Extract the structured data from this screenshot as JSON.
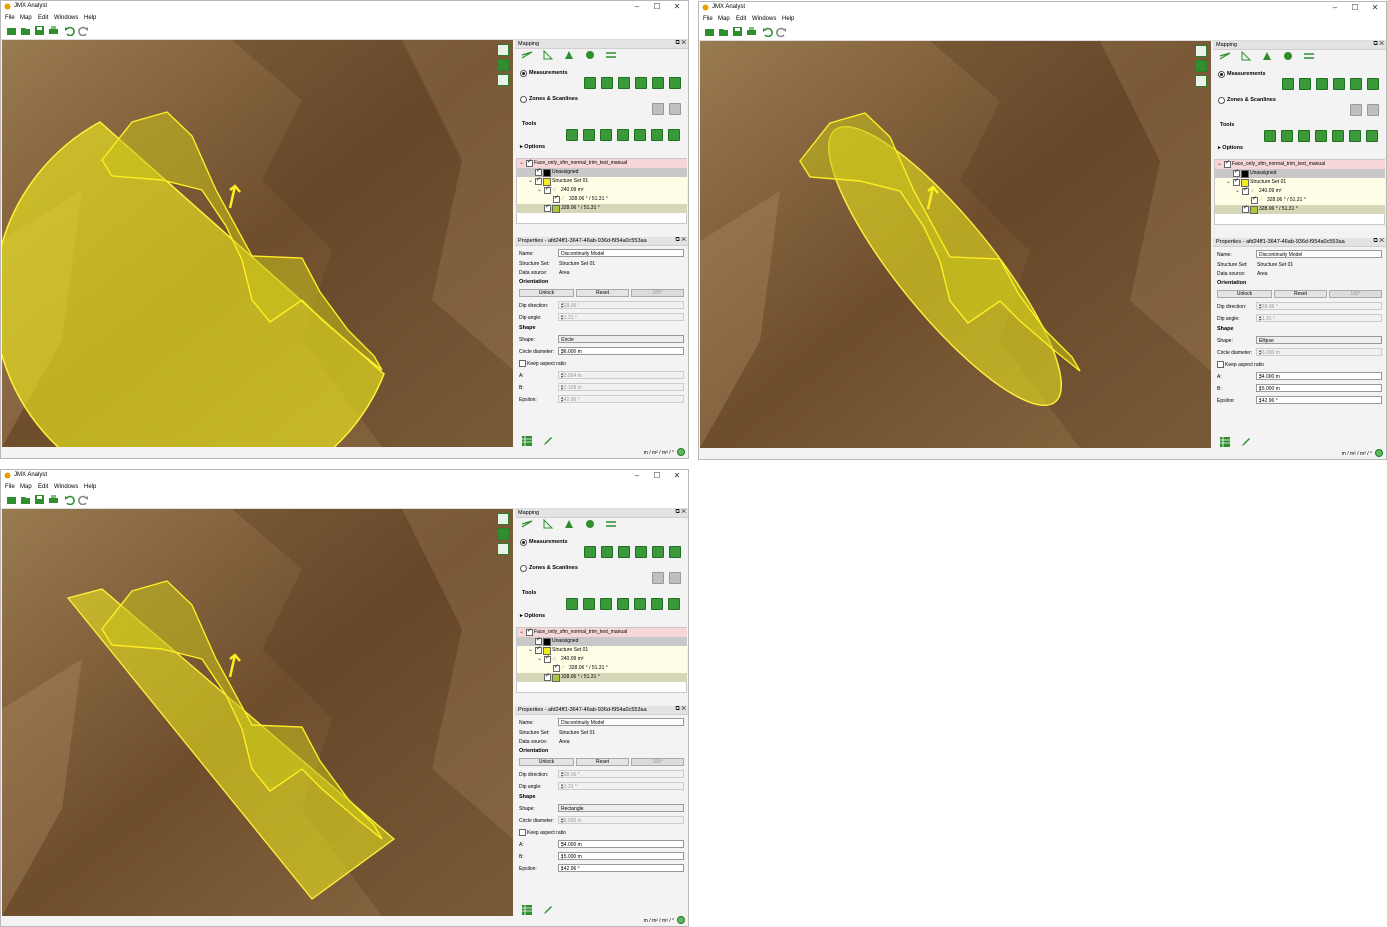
{
  "windows": [
    {
      "title": "JMX Analyst",
      "menu": [
        "File",
        "Map",
        "Edit",
        "Windows",
        "Help"
      ],
      "mapping_title": "Mapping",
      "radio_measurements": "Measurements",
      "radio_zones": "Zones & Scanlines",
      "tools_label": "Tools",
      "options_label": "Options",
      "tree": {
        "root": "Face_only_sfm_normal_trim_test_manual",
        "unassigned": "Unassigned",
        "structure_set": "Structure Set 01",
        "area": "240.09 m²",
        "orientation_leaf": "328.06 ° / 51.31 °",
        "model_leaf": "328.06 ° / 51.31 °"
      },
      "properties": {
        "title": "Properties - afd24ff1-3647-46ab-936d-f954a0c553aa",
        "name_label": "Name:",
        "name_value": "Discontinuity Model",
        "structure_set_label": "Structure Set:",
        "structure_set_value": "Structure Set 01",
        "data_source_label": "Data source:",
        "data_source_value": "Area",
        "orientation_header": "Orientation",
        "unlock_label": "Unlock",
        "reset_label": "Reset",
        "rotate_label": "180°",
        "dip_direction_label": "Dip direction:",
        "dip_direction_value": "328.06 °",
        "dip_angle_label": "Dip angle:",
        "dip_angle_value": "51.31 °",
        "shape_header": "Shape",
        "shape_label": "Shape:",
        "shape_value": "Circle",
        "circle_diameter_label": "Circle diameter:",
        "circle_diameter_value": "36.000 m",
        "keep_aspect_label": "Keep aspect ratio",
        "a_label": "A:",
        "a_value": "33.564 m",
        "b_label": "B:",
        "b_value": "12.109 m",
        "epsilon_label": "Epsilon:",
        "epsilon_value": "142.96 °"
      },
      "status_units": "m / m² / m³ / °"
    },
    {
      "title": "JMX Analyst",
      "menu": [
        "File",
        "Map",
        "Edit",
        "Windows",
        "Help"
      ],
      "mapping_title": "Mapping",
      "radio_measurements": "Measurements",
      "radio_zones": "Zones & Scanlines",
      "tools_label": "Tools",
      "options_label": "Options",
      "tree": {
        "root": "Face_only_sfm_normal_trim_test_manual",
        "unassigned": "Unassigned",
        "structure_set": "Structure Set 01",
        "area": "240.09 m²",
        "orientation_leaf": "328.06 ° / 51.31 °",
        "model_leaf": "328.06 ° / 51.31 °"
      },
      "properties": {
        "title": "Properties - afd24ff1-3647-46ab-936d-f954a0c553aa",
        "name_label": "Name:",
        "name_value": "Discontinuity Model",
        "structure_set_label": "Structure Set:",
        "structure_set_value": "Structure Set 01",
        "data_source_label": "Data source:",
        "data_source_value": "Area",
        "orientation_header": "Orientation",
        "unlock_label": "Unlock",
        "reset_label": "Reset",
        "rotate_label": "180°",
        "dip_direction_label": "Dip direction:",
        "dip_direction_value": "328.06 °",
        "dip_angle_label": "Dip angle:",
        "dip_angle_value": "51.31 °",
        "shape_header": "Shape",
        "shape_label": "Shape:",
        "shape_value": "Ellipse",
        "circle_diameter_label": "Circle diameter:",
        "circle_diameter_value": "36.000 m",
        "keep_aspect_label": "Keep aspect ratio",
        "a_label": "A:",
        "a_value": "34.000 m",
        "b_label": "B:",
        "b_value": "15.000 m",
        "epsilon_label": "Epsilon:",
        "epsilon_value": "142.96 °"
      },
      "status_units": "m / m² / m³ / °"
    },
    {
      "title": "JMX Analyst",
      "menu": [
        "File",
        "Map",
        "Edit",
        "Windows",
        "Help"
      ],
      "mapping_title": "Mapping",
      "radio_measurements": "Measurements",
      "radio_zones": "Zones & Scanlines",
      "tools_label": "Tools",
      "options_label": "Options",
      "tree": {
        "root": "Face_only_sfm_normal_trim_test_manual",
        "unassigned": "Unassigned",
        "structure_set": "Structure Set 01",
        "area": "240.09 m²",
        "orientation_leaf": "328.06 ° / 51.31 °",
        "model_leaf": "328.06 ° / 51.31 °"
      },
      "properties": {
        "title": "Properties - afd24ff1-3647-46ab-936d-f954a0c553aa",
        "name_label": "Name:",
        "name_value": "Discontinuity Model",
        "structure_set_label": "Structure Set:",
        "structure_set_value": "Structure Set 01",
        "data_source_label": "Data source:",
        "data_source_value": "Area",
        "orientation_header": "Orientation",
        "unlock_label": "Unlock",
        "reset_label": "Reset",
        "rotate_label": "180°",
        "dip_direction_label": "Dip direction:",
        "dip_direction_value": "328.06 °",
        "dip_angle_label": "Dip angle:",
        "dip_angle_value": "51.31 °",
        "shape_header": "Shape",
        "shape_label": "Shape:",
        "shape_value": "Rectangle",
        "circle_diameter_label": "Circle diameter:",
        "circle_diameter_value": "36.000 m",
        "keep_aspect_label": "Keep aspect ratio",
        "a_label": "A:",
        "a_value": "34.000 m",
        "b_label": "B:",
        "b_value": "15.000 m",
        "epsilon_label": "Epsilon:",
        "epsilon_value": "142.96 °"
      },
      "status_units": "m / m² / m³ / °"
    }
  ],
  "colors": {
    "accent_green": "#2f8f2f",
    "highlight_yellow": "#f2ee1c",
    "root_row": "#f6d6d6",
    "rock": "#7a5a36"
  }
}
